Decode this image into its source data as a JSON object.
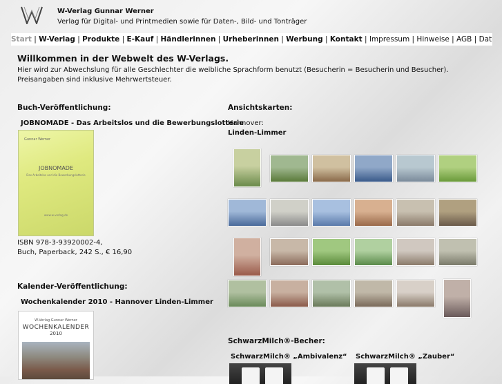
{
  "header": {
    "title": "W-Verlag Gunnar Werner",
    "subtitle": "Verlag für Digital- und Printmedien sowie für Daten-, Bild- und Tonträger"
  },
  "nav": {
    "items": [
      {
        "label": "Start",
        "style": "active"
      },
      {
        "label": "W-Verlag",
        "style": "bold"
      },
      {
        "label": "Produkte",
        "style": "bold"
      },
      {
        "label": "E-Kauf",
        "style": "bold"
      },
      {
        "label": "Händlerinnen",
        "style": "bold"
      },
      {
        "label": "Urheberinnen",
        "style": "bold"
      },
      {
        "label": "Werbung",
        "style": "bold"
      },
      {
        "label": "Kontakt",
        "style": "bold"
      },
      {
        "label": "Impressum",
        "style": "normal"
      },
      {
        "label": "Hinweise",
        "style": "normal"
      },
      {
        "label": "AGB",
        "style": "normal"
      },
      {
        "label": "Datenschutz",
        "style": "normal"
      }
    ]
  },
  "welcome": {
    "title": "Willkommen in der Webwelt des W-Verlags.",
    "line1": "Hier wird zur Abwechslung für alle Geschlechter die weibliche Sprachform benutzt (Besucherin = Besucherin und Besucher).",
    "line2": "Preisangaben sind inklusive Mehrwertsteuer."
  },
  "book_section": {
    "heading": "Buch-Veröffentlichung:",
    "title": "JOBNOMADE - Das Arbeitslos und die Bewerbungslotterie",
    "cover_author": "Gunnar Werner",
    "cover_title": "JOBNOMADE",
    "cover_subtitle": "Das Arbeitslos und die Bewerbungslotterie",
    "cover_url": "www.w-verlag.de",
    "isbn": "ISBN 978-3-93920002-4,",
    "details": "Buch, Paperback, 242 S., € 16,90"
  },
  "calendar_section": {
    "heading": "Kalender-Veröffentlichung:",
    "title": "Wochenkalender 2010 - Hannover Linden-Limmer",
    "cover_publisher": "W-Verlag Gunnar Werner",
    "cover_title": "WOCHENKALENDER",
    "cover_year": "2010"
  },
  "postcards": {
    "heading": "Ansichtskarten:",
    "city": "Hannover:",
    "district": "Linden-Limmer",
    "thumb_colors": [
      [
        "#6a8a4a",
        "#c8d0a0"
      ],
      [
        "#5a7a3a",
        "#a0b890"
      ],
      [
        "#8a6a4a",
        "#d0c0a0"
      ],
      [
        "#3a5a8a",
        "#90a8c8"
      ],
      [
        "#7a8a9a",
        "#b8c8d0"
      ],
      [
        "#6a9a3a",
        "#b0d080"
      ],
      [
        "#4a6a9a",
        "#a0b8d8"
      ],
      [
        "#8a8a8a",
        "#d0d0c8"
      ],
      [
        "#5a7aaa",
        "#a8c0e0"
      ],
      [
        "#9a6a4a",
        "#d8b090"
      ],
      [
        "#8a7a6a",
        "#c8c0b0"
      ],
      [
        "#6a5a4a",
        "#b0a080"
      ],
      [
        "#9a5a4a",
        "#d0b0a0"
      ],
      [
        "#8a6a5a",
        "#c8b8a8"
      ],
      [
        "#5a8a3a",
        "#a0c880"
      ],
      [
        "#5a8a4a",
        "#b0d0a0"
      ],
      [
        "#8a7a6a",
        "#d0c8c0"
      ],
      [
        "#7a7a6a",
        "#c0c0b0"
      ],
      [
        "#6a8a5a",
        "#b0c0a0"
      ],
      [
        "#8a5a4a",
        "#c8b0a0"
      ],
      [
        "#6a7a5a",
        "#b0c0a8"
      ],
      [
        "#7a6a5a",
        "#c0b8a8"
      ],
      [
        "#8a7a6a",
        "#d8d0c8"
      ],
      [
        "#6a5a5a",
        "#c0b0a8"
      ]
    ]
  },
  "mugs": {
    "heading": "SchwarzMilch®-Becher:",
    "items": [
      {
        "label": "SchwarzMilch® „Ambivalenz“"
      },
      {
        "label": "SchwarzMilch® „Zauber“"
      }
    ]
  }
}
